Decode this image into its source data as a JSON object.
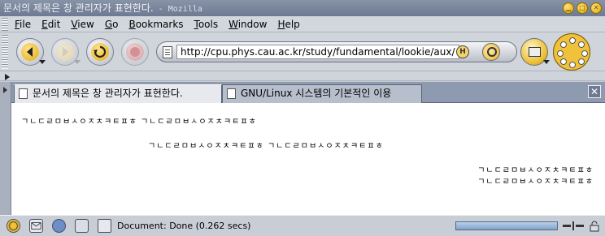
{
  "window": {
    "title": "문서의 제목은 창 관리자가 표현한다.",
    "title_suffix": " - Mozilla",
    "controls": [
      "minimize",
      "maximize",
      "close"
    ]
  },
  "menubar": {
    "items": [
      {
        "key": "F",
        "rest": "ile"
      },
      {
        "key": "E",
        "rest": "dit"
      },
      {
        "key": "V",
        "rest": "iew"
      },
      {
        "key": "G",
        "rest": "o"
      },
      {
        "key": "B",
        "rest": "ookmarks"
      },
      {
        "key": "T",
        "rest": "ools"
      },
      {
        "key": "W",
        "rest": "indow"
      },
      {
        "key": "H",
        "rest": "elp"
      }
    ]
  },
  "navbar": {
    "url": "http://cpu.phys.cau.ac.kr/study/fundamental/lookie/aux/",
    "history_glyph": "H",
    "accent": "#e8b929"
  },
  "tabs": {
    "items": [
      {
        "label": "문서의 제목은 창 관리자가 표현한다.",
        "active": true
      },
      {
        "label": "GNU/Linux 시스템의 기본적인 이용",
        "active": false
      }
    ],
    "close_glyph": "✕"
  },
  "content": {
    "lines": [
      {
        "text": "ㄱㄴㄷㄹㅁㅂㅅㅇㅈㅊㅋㅌㅍㅎ ㄱㄴㄷㄹㅁㅂㅅㅇㅈㅊㅋㅌㅍㅎ",
        "align": "left"
      },
      {
        "text": "ㄱㄴㄷㄹㅁㅂㅅㅇㅈㅊㅋㅌㅍㅎ ㄱㄴㄷㄹㅁㅂㅅㅇㅈㅊㅋㅌㅍㅎ",
        "align": "center"
      },
      {
        "text": "ㄱㄴㄷㄹㅁㅂㅅㅇㅈㅊㅋㅌㅍㅎ",
        "align": "right"
      },
      {
        "text": "ㄱㄴㄷㄹㅁㅂㅅㅇㅈㅊㅋㅌㅍㅎ",
        "align": "right"
      }
    ]
  },
  "statusbar": {
    "text": "Document: Done (0.262 secs)",
    "progress": 1.0
  }
}
